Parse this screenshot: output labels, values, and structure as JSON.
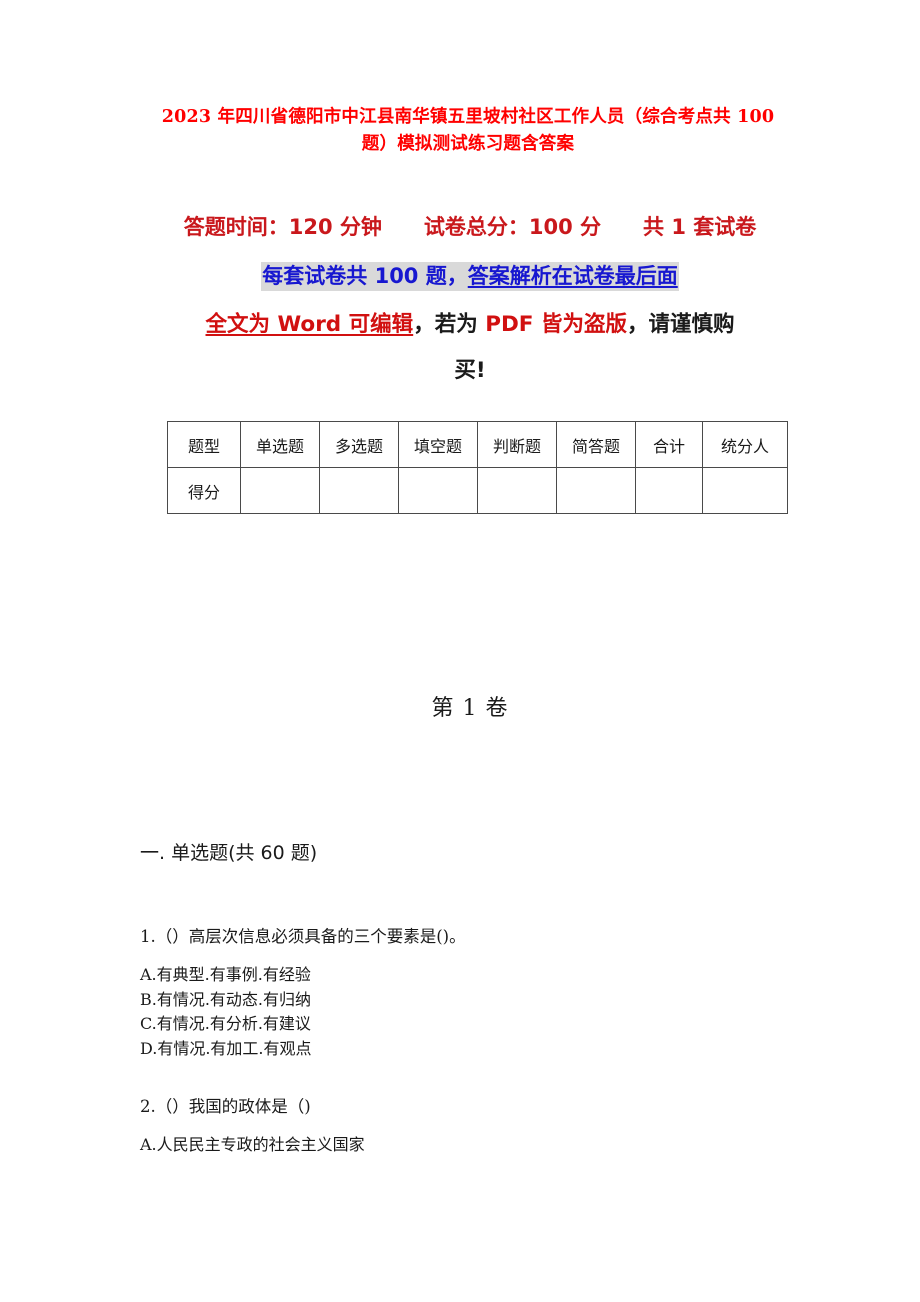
{
  "document": {
    "title": "2023 年四川省德阳市中江县南华镇五里坡村社区工作人员（综合考点共 100 题）模拟测试练习题含答案",
    "info_line": "答题时间：120 分钟　　试卷总分：100 分　　共 1 套试卷",
    "highlight_line": {
      "plain": "每套试卷共 100 题，",
      "underlined": "答案解析在试卷最后面"
    },
    "warning_line": {
      "part1_red_underlined": "全文为 Word 可编辑",
      "part2_dark": "，若为 ",
      "part3_red": "PDF 皆为盗版",
      "part4_dark": "，请谨慎购",
      "part5_dark": "买!"
    },
    "volume_heading": "第 1 卷",
    "section_heading": "一. 单选题(共 60 题)"
  },
  "colors": {
    "title_red": "#ff0000",
    "info_red": "#c9181c",
    "highlight_blue": "#1717d0",
    "highlight_bg": "#d9d9d9",
    "warn_red": "#d11010",
    "text_dark": "#1a1a1a",
    "table_border": "#4a4a4a"
  },
  "score_table": {
    "headers": [
      "题型",
      "单选题",
      "多选题",
      "填空题",
      "判断题",
      "简答题",
      "合计",
      "统分人"
    ],
    "rows": [
      {
        "label": "得分",
        "cells": [
          "",
          "",
          "",
          "",
          "",
          "",
          ""
        ]
      }
    ]
  },
  "questions": [
    {
      "stem": "1.（）高层次信息必须具备的三个要素是()。",
      "options": [
        "A.有典型.有事例.有经验",
        "B.有情况.有动态.有归纳",
        "C.有情况.有分析.有建议",
        "D.有情况.有加工.有观点"
      ]
    },
    {
      "stem": "2.（）我国的政体是（)",
      "options": [
        "A.人民民主专政的社会主义国家"
      ]
    }
  ]
}
